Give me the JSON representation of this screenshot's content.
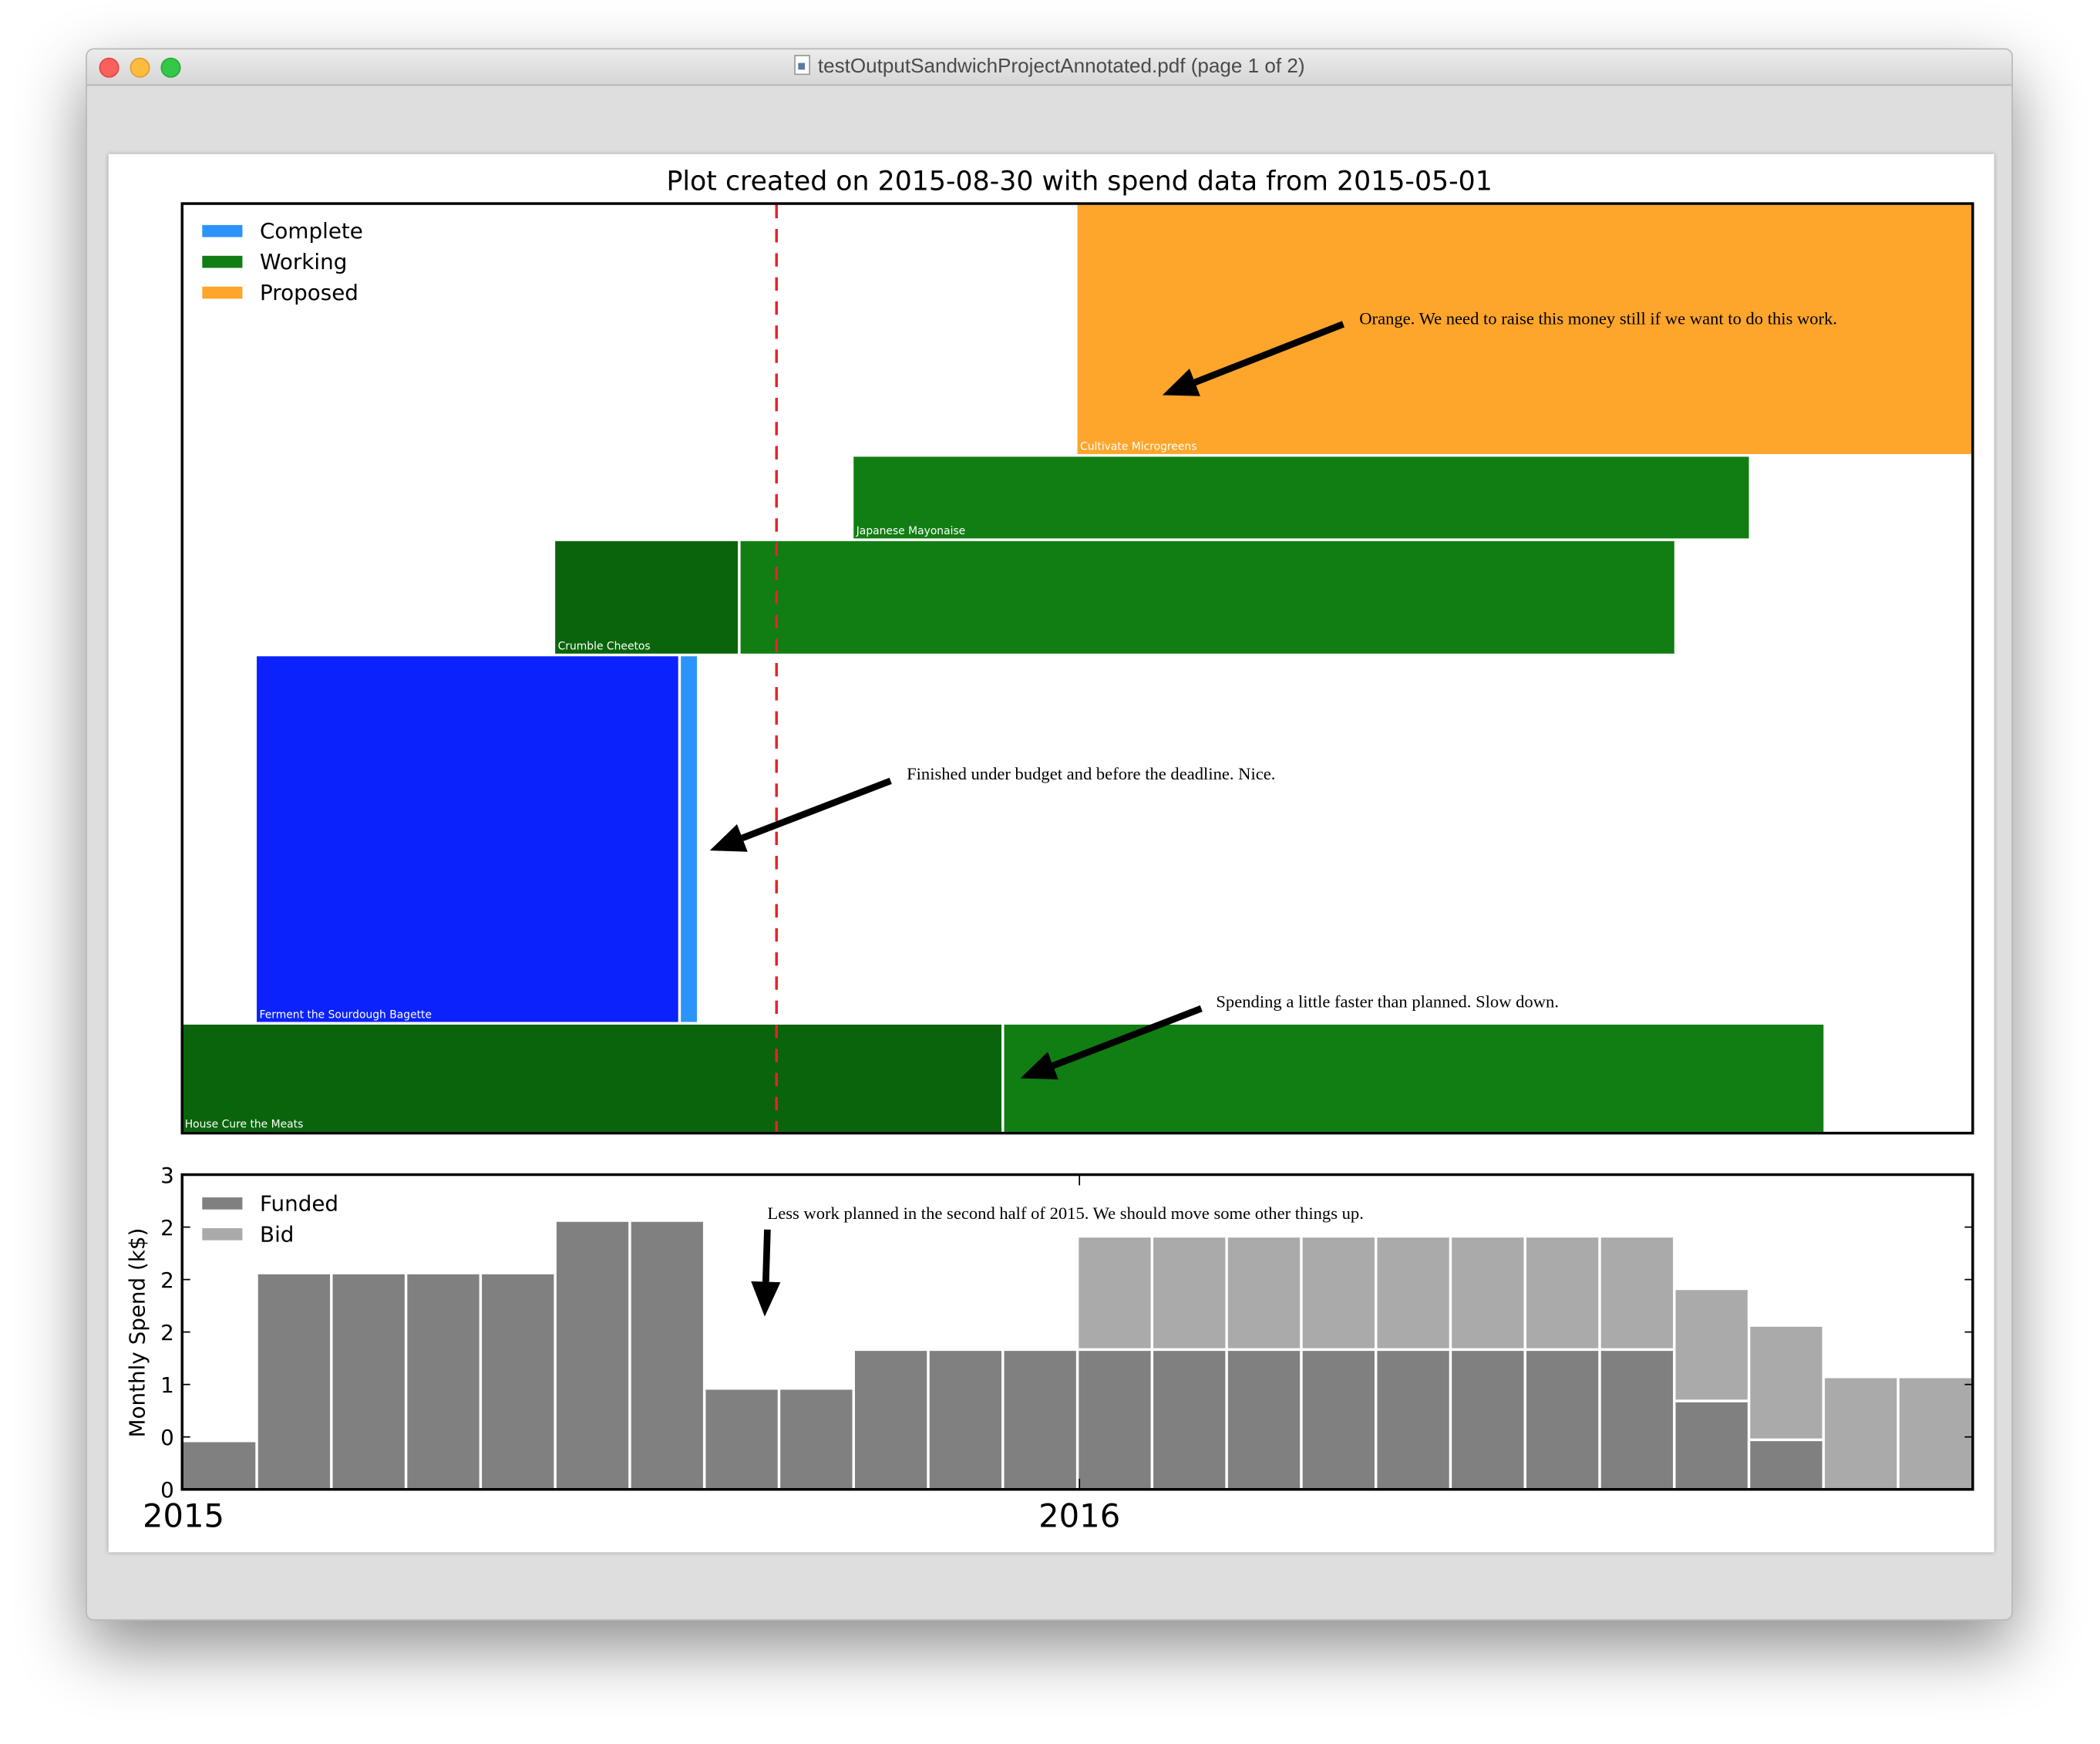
{
  "window": {
    "title": "testOutputSandwichProjectAnnotated.pdf (page 1 of 2)",
    "traffic_lights": {
      "close": "#fc605b",
      "minimize": "#fdbc40",
      "zoom": "#34c84a"
    }
  },
  "chart_data": [
    {
      "type": "gantt",
      "title": "Plot created on 2015-08-30 with spend data from 2015-05-01",
      "xlim": [
        "2015-01-01",
        "2017-01-01"
      ],
      "grid": false,
      "legend_position": "top-left",
      "legend": [
        {
          "label": "Complete",
          "color": "#2b94fb"
        },
        {
          "label": "Working",
          "color": "#107e12"
        },
        {
          "label": "Proposed",
          "color": "#fea52b"
        }
      ],
      "current_date_line": {
        "date": "2015-08-30",
        "color": "#e8222a",
        "style": "dashed"
      },
      "tasks": [
        {
          "name": "Cultivate Microgreens",
          "segments": [
            {
              "start": "2016-01-01",
              "end": "2017-01-01",
              "color": "#fea52b"
            }
          ]
        },
        {
          "name": "Japanese Mayonaise",
          "segments": [
            {
              "start": "2015-10-01",
              "end": "2016-10-01",
              "color": "#107e12"
            }
          ]
        },
        {
          "name": "Crumble Cheetos",
          "segments": [
            {
              "start": "2015-06-01",
              "end": "2015-08-15",
              "color": "#0a640c"
            },
            {
              "start": "2015-08-15",
              "end": "2016-09-01",
              "color": "#107e12"
            }
          ]
        },
        {
          "name": "Ferment the Sourdough Bagette",
          "segments": [
            {
              "start": "2015-02-01",
              "end": "2015-07-21",
              "color": "#0b22fd"
            },
            {
              "start": "2015-07-21",
              "end": "2015-07-28",
              "color": "#2b94fb"
            }
          ]
        },
        {
          "name": "House Cure the Meats",
          "segments": [
            {
              "start": "2015-01-01",
              "end": "2015-12-01",
              "color": "#0a640c"
            },
            {
              "start": "2015-12-01",
              "end": "2016-11-01",
              "color": "#107e12"
            }
          ]
        }
      ],
      "annotations": [
        "Orange. We need to raise this money still if we want to do this work.",
        "Finished under budget and before the deadline. Nice.",
        "Spending a little faster than planned. Slow down."
      ]
    },
    {
      "type": "bar",
      "stacked": true,
      "ylabel": "Monthly Spend (k$)",
      "ylim": [
        0,
        3
      ],
      "yticks": [
        0,
        0.5,
        1,
        1.5,
        2,
        2.5,
        3
      ],
      "ytick_labels": [
        "0",
        "0",
        "1",
        "2",
        "2",
        "2",
        "3"
      ],
      "xtick_labels": [
        "2015",
        "2016"
      ],
      "xlim": [
        "2015-01",
        "2017-01"
      ],
      "legend_position": "top-left",
      "categories": [
        "2015-01",
        "2015-02",
        "2015-03",
        "2015-04",
        "2015-05",
        "2015-06",
        "2015-07",
        "2015-08",
        "2015-09",
        "2015-10",
        "2015-11",
        "2015-12",
        "2016-01",
        "2016-02",
        "2016-03",
        "2016-04",
        "2016-05",
        "2016-06",
        "2016-07",
        "2016-08",
        "2016-09",
        "2016-10",
        "2016-11",
        "2016-12"
      ],
      "series": [
        {
          "name": "Funded",
          "color": "#808080",
          "values": [
            0.45,
            2.05,
            2.05,
            2.05,
            2.05,
            2.55,
            2.55,
            0.95,
            0.95,
            1.32,
            1.32,
            1.32,
            1.32,
            1.32,
            1.32,
            1.32,
            1.32,
            1.32,
            1.32,
            1.32,
            0.83,
            0.46,
            0,
            0
          ]
        },
        {
          "name": "Bid",
          "color": "#aaaaaa",
          "values": [
            0,
            0,
            0,
            0,
            0,
            0,
            0,
            0,
            0,
            0,
            0,
            0,
            1.08,
            1.08,
            1.08,
            1.08,
            1.08,
            1.08,
            1.08,
            1.08,
            1.07,
            1.09,
            1.06,
            1.06
          ]
        }
      ],
      "annotations": [
        "Less work planned in the second half of 2015. We should move some other things up."
      ]
    }
  ]
}
